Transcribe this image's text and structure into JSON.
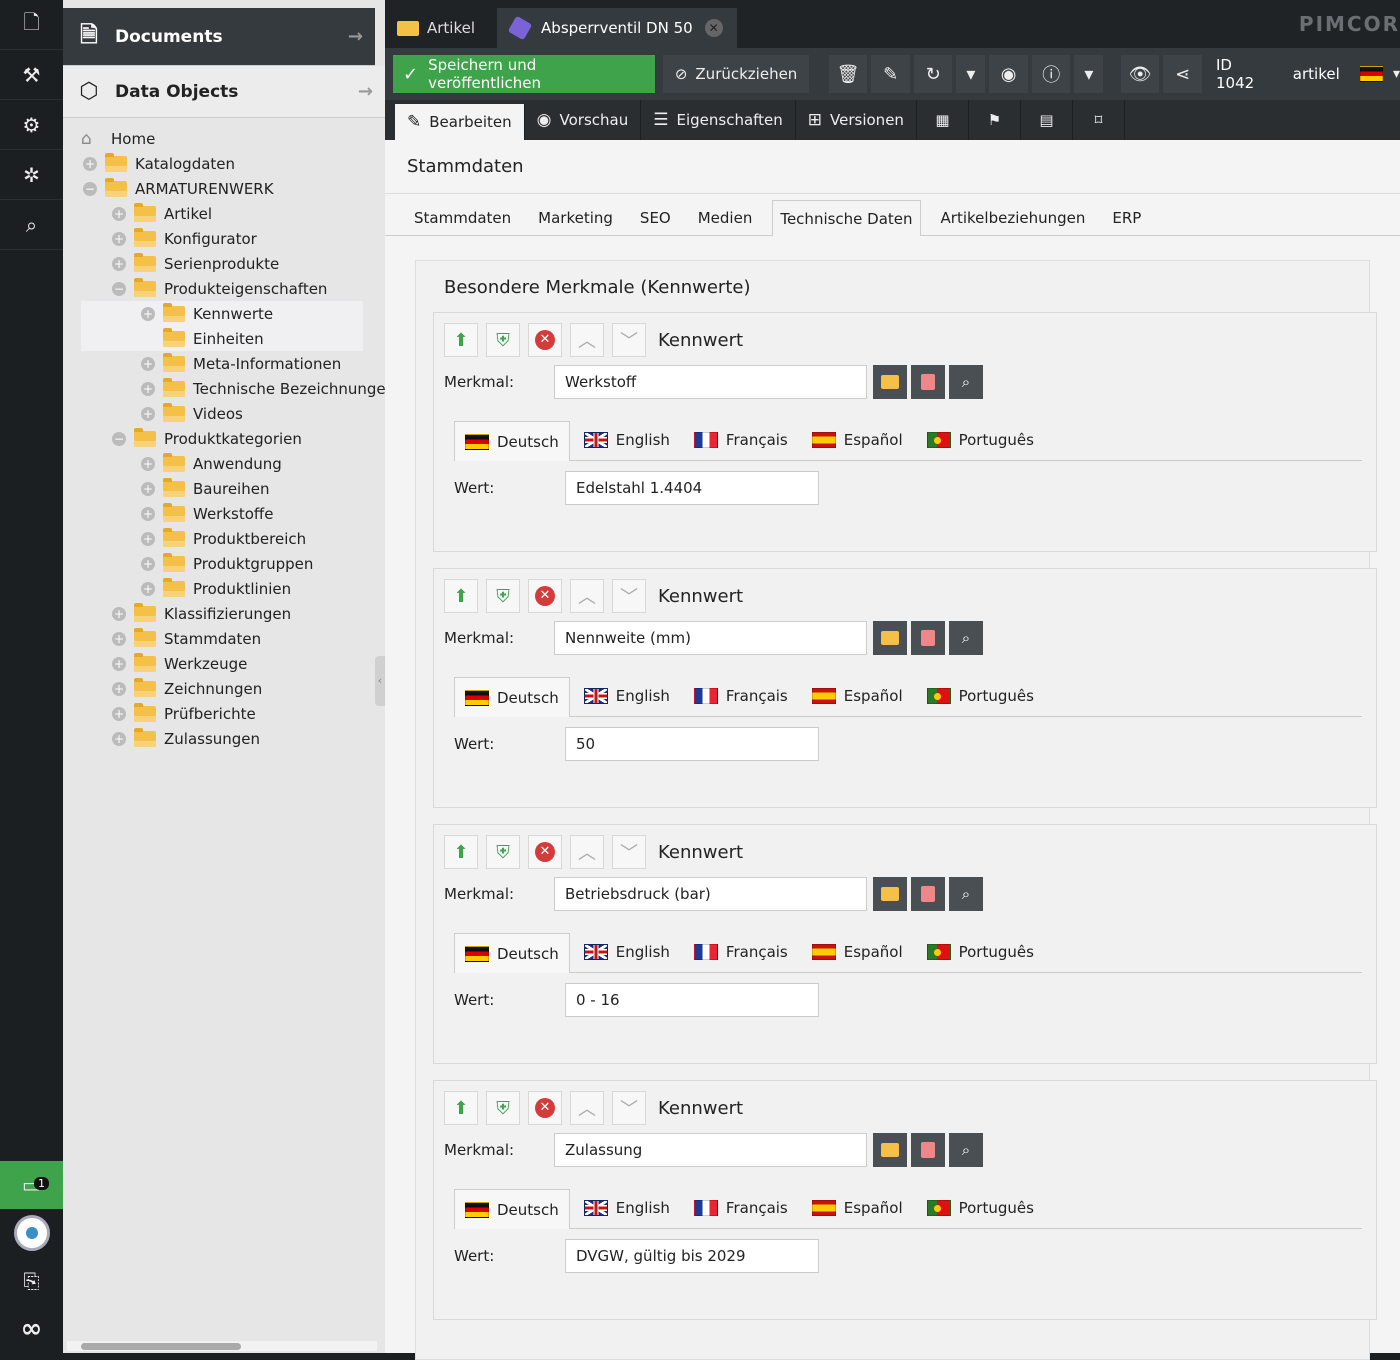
{
  "tree": {
    "documents_label": "Documents",
    "data_objects_label": "Data Objects",
    "nodes": [
      {
        "label": "Home"
      },
      {
        "label": "Katalogdaten"
      },
      {
        "label": "ARMATURENWERK"
      },
      {
        "label": "Artikel"
      },
      {
        "label": "Konfigurator"
      },
      {
        "label": "Serienprodukte"
      },
      {
        "label": "Produkteigenschaften"
      },
      {
        "label": "Kennwerte"
      },
      {
        "label": "Einheiten"
      },
      {
        "label": "Meta-Informationen"
      },
      {
        "label": "Technische Bezeichnungen"
      },
      {
        "label": "Videos"
      },
      {
        "label": "Produktkategorien"
      },
      {
        "label": "Anwendung"
      },
      {
        "label": "Baureihen"
      },
      {
        "label": "Werkstoffe"
      },
      {
        "label": "Produktbereich"
      },
      {
        "label": "Produktgruppen"
      },
      {
        "label": "Produktlinien"
      },
      {
        "label": "Klassifizierungen"
      },
      {
        "label": "Stammdaten"
      },
      {
        "label": "Werkzeuge"
      },
      {
        "label": "Zeichnungen"
      },
      {
        "label": "Prüfberichte"
      },
      {
        "label": "Zulassungen"
      }
    ]
  },
  "rail": {
    "notification_count": "1"
  },
  "tabs": {
    "folder_tab": "Artikel",
    "object_tab": "Absperrventil DN 50"
  },
  "brand": "PIMCOR",
  "toolbar": {
    "save_label": "Speichern und veröffentlichen",
    "unpublish_label": "Zurückziehen",
    "id_label": "ID 1042",
    "class_label": "artikel"
  },
  "edit_tabs": {
    "edit": "Bearbeiten",
    "preview": "Vorschau",
    "properties": "Eigenschaften",
    "versions": "Versionen"
  },
  "panel_title": "Stammdaten",
  "sub_tabs": [
    "Stammdaten",
    "Marketing",
    "SEO",
    "Medien",
    "Technische Daten",
    "Artikelbeziehungen",
    "ERP"
  ],
  "fieldset_title": "Besondere Merkmale (Kennwerte)",
  "labels": {
    "block": "Kennwert",
    "merkmal": "Merkmal:",
    "wert": "Wert:"
  },
  "languages": [
    "Deutsch",
    "English",
    "Français",
    "Español",
    "Português"
  ],
  "blocks": [
    {
      "merkmal": "Werkstoff",
      "wert": "Edelstahl 1.4404"
    },
    {
      "merkmal": "Nennweite (mm)",
      "wert": "50"
    },
    {
      "merkmal": "Betriebsdruck (bar)",
      "wert": "0 - 16"
    },
    {
      "merkmal": "Zulassung",
      "wert": "DVGW, gültig bis 2029"
    }
  ],
  "colors": {
    "accent_green": "#3ea34a",
    "delete_red": "#d43b3b",
    "dark_bar": "#353a3e"
  }
}
